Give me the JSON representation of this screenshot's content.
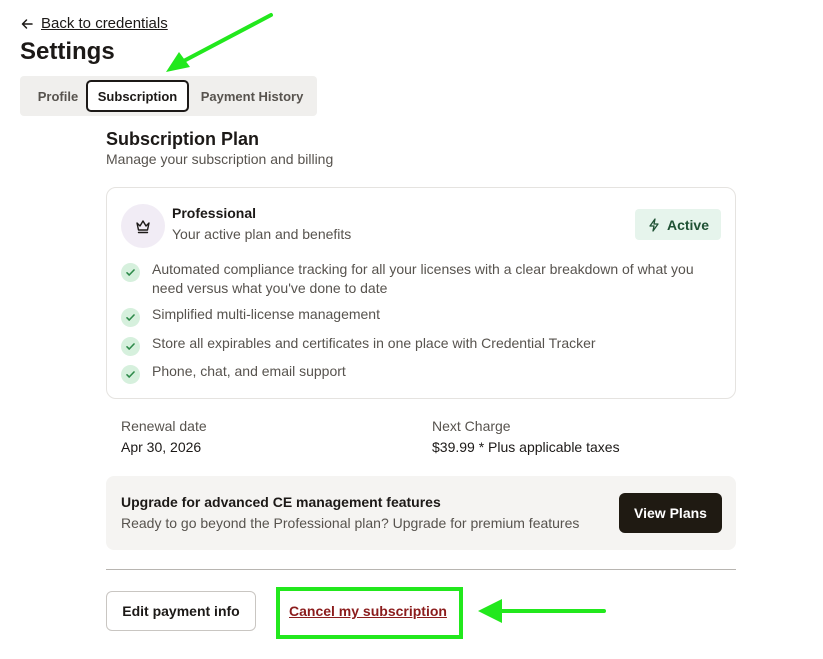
{
  "nav": {
    "back_label": "Back to credentials"
  },
  "page": {
    "title": "Settings"
  },
  "tabs": [
    {
      "label": "Profile",
      "selected": false
    },
    {
      "label": "Subscription",
      "selected": true
    },
    {
      "label": "Payment History",
      "selected": false
    }
  ],
  "subscription": {
    "title": "Subscription Plan",
    "subtitle": "Manage your subscription and billing"
  },
  "plan": {
    "name": "Professional",
    "description": "Your active plan and benefits",
    "status": "Active",
    "icon": "crown-icon",
    "status_icon": "lightning-icon",
    "features": [
      "Automated compliance tracking for all your licenses with a clear breakdown of what you need versus what you've done to date",
      "Simplified multi-license management",
      "Store all expirables and certificates in one place with Credential Tracker",
      "Phone, chat, and email support"
    ]
  },
  "billing": {
    "renewal_label": "Renewal date",
    "renewal_value": "Apr 30, 2026",
    "charge_label": "Next Charge",
    "charge_value": "$39.99 * Plus applicable taxes"
  },
  "upgrade": {
    "title": "Upgrade for advanced CE management features",
    "subtitle": "Ready to go beyond the Professional plan? Upgrade for premium features",
    "button_label": "View Plans"
  },
  "actions": {
    "edit_payment_label": "Edit payment info",
    "cancel_label": "Cancel my subscription"
  },
  "colors": {
    "highlight": "#22e81d",
    "cancel_text": "#8b1c1c",
    "active_badge_bg": "#e6f4ec",
    "primary_button": "#1f1a12"
  }
}
